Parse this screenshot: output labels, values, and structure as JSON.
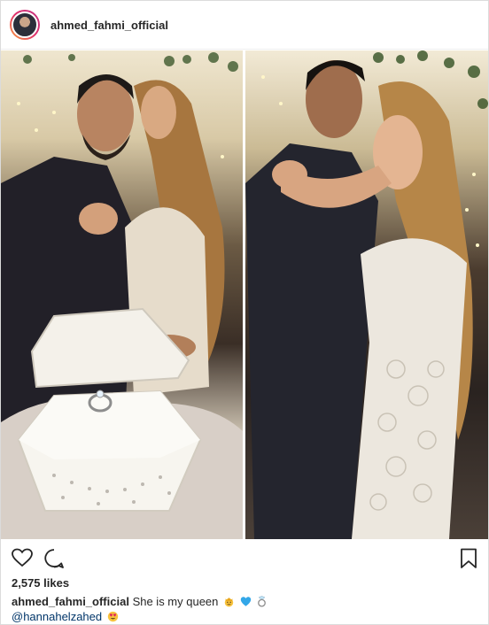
{
  "header": {
    "username": "ahmed_fahmi_official"
  },
  "actions": {
    "like_icon": "heart-outline-icon",
    "comment_icon": "speech-bubble-icon",
    "save_icon": "bookmark-icon"
  },
  "likes": {
    "count_text": "2,575 likes"
  },
  "caption": {
    "username": "ahmed_fahmi_official",
    "text": "She is my queen",
    "emojis": [
      "crowned-face-emoji",
      "blue-heart-emoji",
      "ring-emoji",
      "heart-eyes-emoji"
    ],
    "mention": "@hannahelzahed"
  }
}
